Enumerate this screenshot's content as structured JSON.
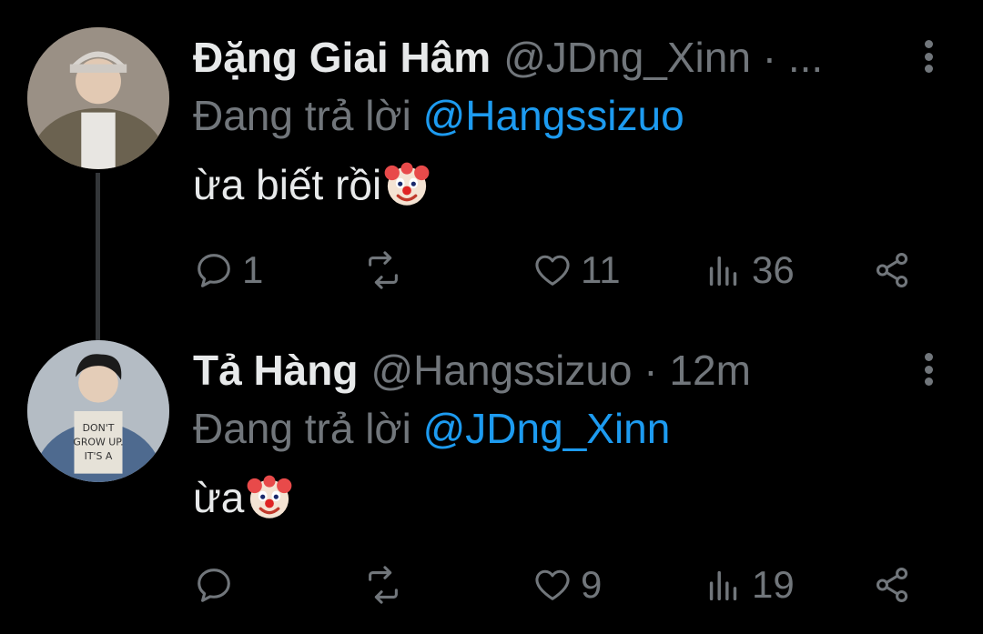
{
  "tweets": [
    {
      "name": "Đặng Giai Hâm",
      "handle": "@JDng_Xinn · ...",
      "replying_prefix": "Đang trả lời",
      "replying_to": "@Hangssizuo",
      "text": "ừa biết rồi",
      "emoji": "clown-face",
      "reply_count": "1",
      "retweet_count": "",
      "like_count": "11",
      "view_count": "36"
    },
    {
      "name": "Tả Hàng",
      "handle": "@Hangssizuo · 12m",
      "replying_prefix": "Đang trả lời",
      "replying_to": "@JDng_Xinn",
      "text": "ừa",
      "emoji": "clown-face",
      "reply_count": "",
      "retweet_count": "",
      "like_count": "9",
      "view_count": "19"
    }
  ],
  "colors": {
    "background": "#000000",
    "primary_text": "#e7e9ea",
    "secondary_text": "#71767b",
    "mention": "#1d9bf0",
    "thread_line": "#333639"
  }
}
